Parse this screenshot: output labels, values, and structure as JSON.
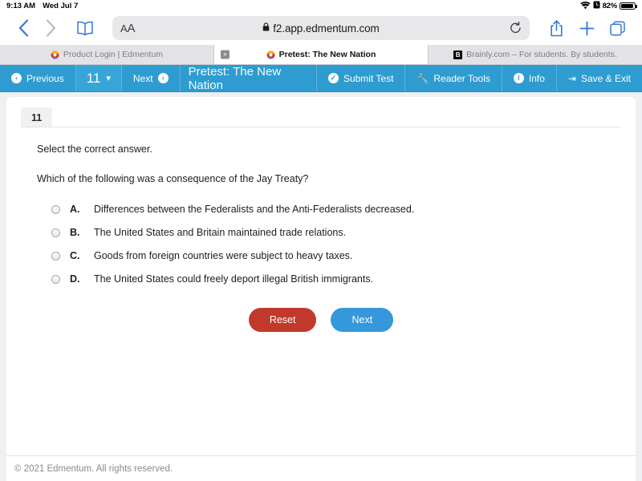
{
  "status_bar": {
    "time": "9:13 AM",
    "date": "Wed Jul 7",
    "wifi_icon": "wifi-icon",
    "alarm_icon": "alarm-icon",
    "battery_percent": "82%",
    "battery_level": 82
  },
  "browser": {
    "back_icon": "chevron-left-icon",
    "forward_icon": "chevron-right-icon",
    "bookmarks_icon": "book-icon",
    "aa_label": "A",
    "aa_label_big": "A",
    "lock_icon": "lock-icon",
    "url": "f2.app.edmentum.com",
    "reload_icon": "reload-icon",
    "share_icon": "share-icon",
    "new_tab_icon": "plus-icon",
    "tab_overview_icon": "tabs-icon",
    "tabs": [
      {
        "title": "Product Login | Edmentum",
        "favicon": "edmentum-favicon",
        "active": false
      },
      {
        "title": "Pretest: The New Nation",
        "favicon": "edmentum-favicon",
        "active": true,
        "close_icon": "close-icon"
      },
      {
        "title": "Brainly.com – For students. By students.",
        "favicon": "brainly-favicon",
        "favicon_letter": "B",
        "active": false
      }
    ]
  },
  "toolbar": {
    "previous_label": "Previous",
    "previous_icon": "arrow-left-circle-icon",
    "page_number": "11",
    "page_chevron_icon": "chevron-down-icon",
    "next_label": "Next",
    "next_icon": "arrow-right-circle-icon",
    "title": "Pretest: The New Nation",
    "submit_label": "Submit Test",
    "submit_icon": "check-circle-icon",
    "reader_tools_label": "Reader Tools",
    "reader_tools_icon": "wrench-icon",
    "info_label": "Info",
    "info_icon": "info-circle-icon",
    "save_exit_label": "Save & Exit",
    "save_exit_icon": "sign-out-icon",
    "accent_color": "#2e9cd0"
  },
  "question": {
    "number_tab": "11",
    "instruction": "Select the correct answer.",
    "text": "Which of the following was a consequence of the Jay Treaty?",
    "choices": [
      {
        "letter": "A.",
        "text": "Differences between the Federalists and the Anti-Federalists decreased.",
        "selected": false
      },
      {
        "letter": "B.",
        "text": "The United States and Britain maintained trade relations.",
        "selected": false
      },
      {
        "letter": "C.",
        "text": "Goods from foreign countries were subject to heavy taxes.",
        "selected": false
      },
      {
        "letter": "D.",
        "text": "The United States could freely deport illegal British immigrants.",
        "selected": false
      }
    ],
    "reset_label": "Reset",
    "next_label": "Next",
    "reset_color": "#c0392b",
    "next_color": "#3498db"
  },
  "footer": {
    "copyright": "© 2021 Edmentum. All rights reserved."
  }
}
